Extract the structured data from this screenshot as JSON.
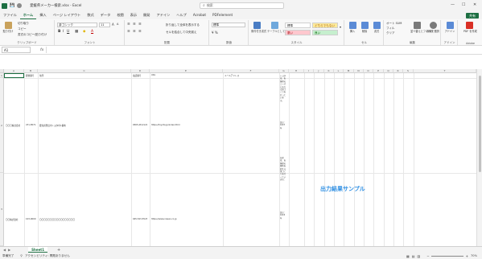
{
  "window": {
    "title": "愛媛県メーカー検索.xlsx - Excel",
    "search_placeholder": "検索"
  },
  "menu": {
    "tabs": [
      "ファイル",
      "ホーム",
      "挿入",
      "ページ レイアウト",
      "数式",
      "データ",
      "校閲",
      "表示",
      "開発",
      "アドイン",
      "ヘルプ",
      "Acrobat",
      "PDFelement"
    ],
    "active_tab": "ホーム",
    "share_label": "共有"
  },
  "ribbon": {
    "clipboard": {
      "paste_label": "貼り付け",
      "cut_label": "切り取り",
      "copy_label": "コピー",
      "format_painter_label": "書式のコピー/貼り付け",
      "group_label": "クリップボード"
    },
    "font": {
      "font_name": "游ゴシック",
      "font_size": "11",
      "group_label": "フォント"
    },
    "alignment": {
      "wrap_label": "折り返して全体を表示する",
      "merge_label": "セルを結合して中央揃え",
      "group_label": "配置"
    },
    "number": {
      "format": "標準",
      "group_label": "数値"
    },
    "styles": {
      "conditional_label": "条件付き書式",
      "table_label": "テーブルとして書式設定",
      "style_normal": "標準",
      "style_neutral": "どちらでもない",
      "style_bad": "悪い",
      "style_good": "良い",
      "group_label": "スタイル"
    },
    "cells": {
      "insert_label": "挿入",
      "delete_label": "削除",
      "format_label": "書式",
      "group_label": "セル"
    },
    "editing": {
      "autosum_label": "オート SUM",
      "fill_label": "フィル",
      "clear_label": "クリア",
      "sort_label": "並べ替えとフィルター",
      "find_label": "検索と選択",
      "group_label": "編集"
    },
    "addins": {
      "addin_label": "アドイン",
      "group_label": "アドイン"
    },
    "adobe": {
      "pdf_label": "PDF を作成",
      "group_label": "Adobe"
    }
  },
  "formula_bar": {
    "name_box": "A1",
    "fx": "fx"
  },
  "columns": [
    "A",
    "B",
    "C",
    "D",
    "E",
    "F",
    "G",
    "H",
    "I",
    "J",
    "K",
    "L",
    "M",
    "N",
    "O",
    "P",
    "Q",
    "R",
    "S",
    "T"
  ],
  "rows": [
    "1",
    "2",
    "3"
  ],
  "headers": {
    "b": "郵便番号",
    "c": "住所",
    "d": "電話番号",
    "e": "URL",
    "f": "メールアドレス"
  },
  "row2": {
    "a": "〇〇〇株式会社",
    "b": "471-8571",
    "c": "愛知県豊田市トヨタ町1番地",
    "d": "0565-28-2121",
    "e": "https://toyota.jp/index.html",
    "g_top": "トヨタは、お客様のニーズに応える車づくりを行っています。",
    "g_bottom": "設立：1937年"
  },
  "row3": {
    "a": "〇〇株式会社",
    "b": "103-0000",
    "c": "〇〇〇〇〇〇〇〇〇〇〇〇〇〇〇〇〇",
    "d": "045-523-5523",
    "e": "https://www.nissan.co.jp",
    "g_top": "日産は、お客様の期待を超える車づくりを行っています。",
    "g_bottom": "設立：1933年"
  },
  "watermark": "出力結果サンプル",
  "sheet": {
    "name": "Sheet1",
    "add": "+"
  },
  "status": {
    "ready": "準備完了",
    "accessibility": "アクセシビリティ: 問題ありません",
    "zoom": "70%"
  }
}
